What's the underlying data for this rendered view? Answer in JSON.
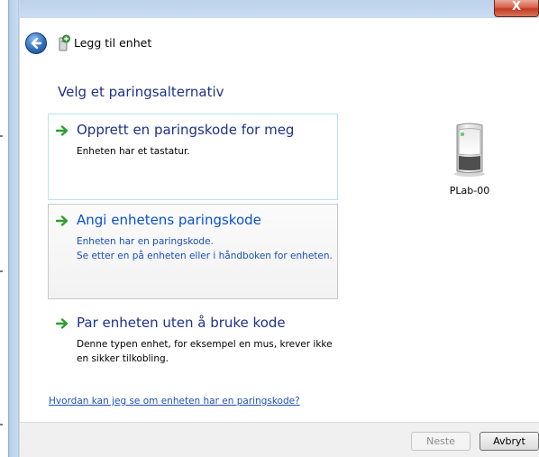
{
  "window": {
    "close_glyph": "X",
    "title": "Legg til enhet"
  },
  "main": {
    "heading": "Velg et paringsalternativ",
    "options": [
      {
        "title": "Opprett en paringskode for meg",
        "description": "Enheten har et tastatur."
      },
      {
        "title": "Angi enhetens paringskode",
        "description": "Enheten har en paringskode.\nSe etter en på enheten eller i håndboken for enheten."
      },
      {
        "title": "Par enheten uten å bruke kode",
        "description": "Denne typen enhet, for eksempel en mus, krever ikke en sikker tilkobling."
      }
    ],
    "device": {
      "label": "PLab-00",
      "icon": "pc-tower-icon"
    },
    "help_link": "Hvordan kan jeg se om enheten har en paringskode?"
  },
  "footer": {
    "next_label": "Neste",
    "cancel_label": "Avbryt"
  },
  "colors": {
    "heading": "#1e3287",
    "link": "#1f50b8",
    "arrow": "#2e9e2e",
    "close": "#c23b22"
  }
}
